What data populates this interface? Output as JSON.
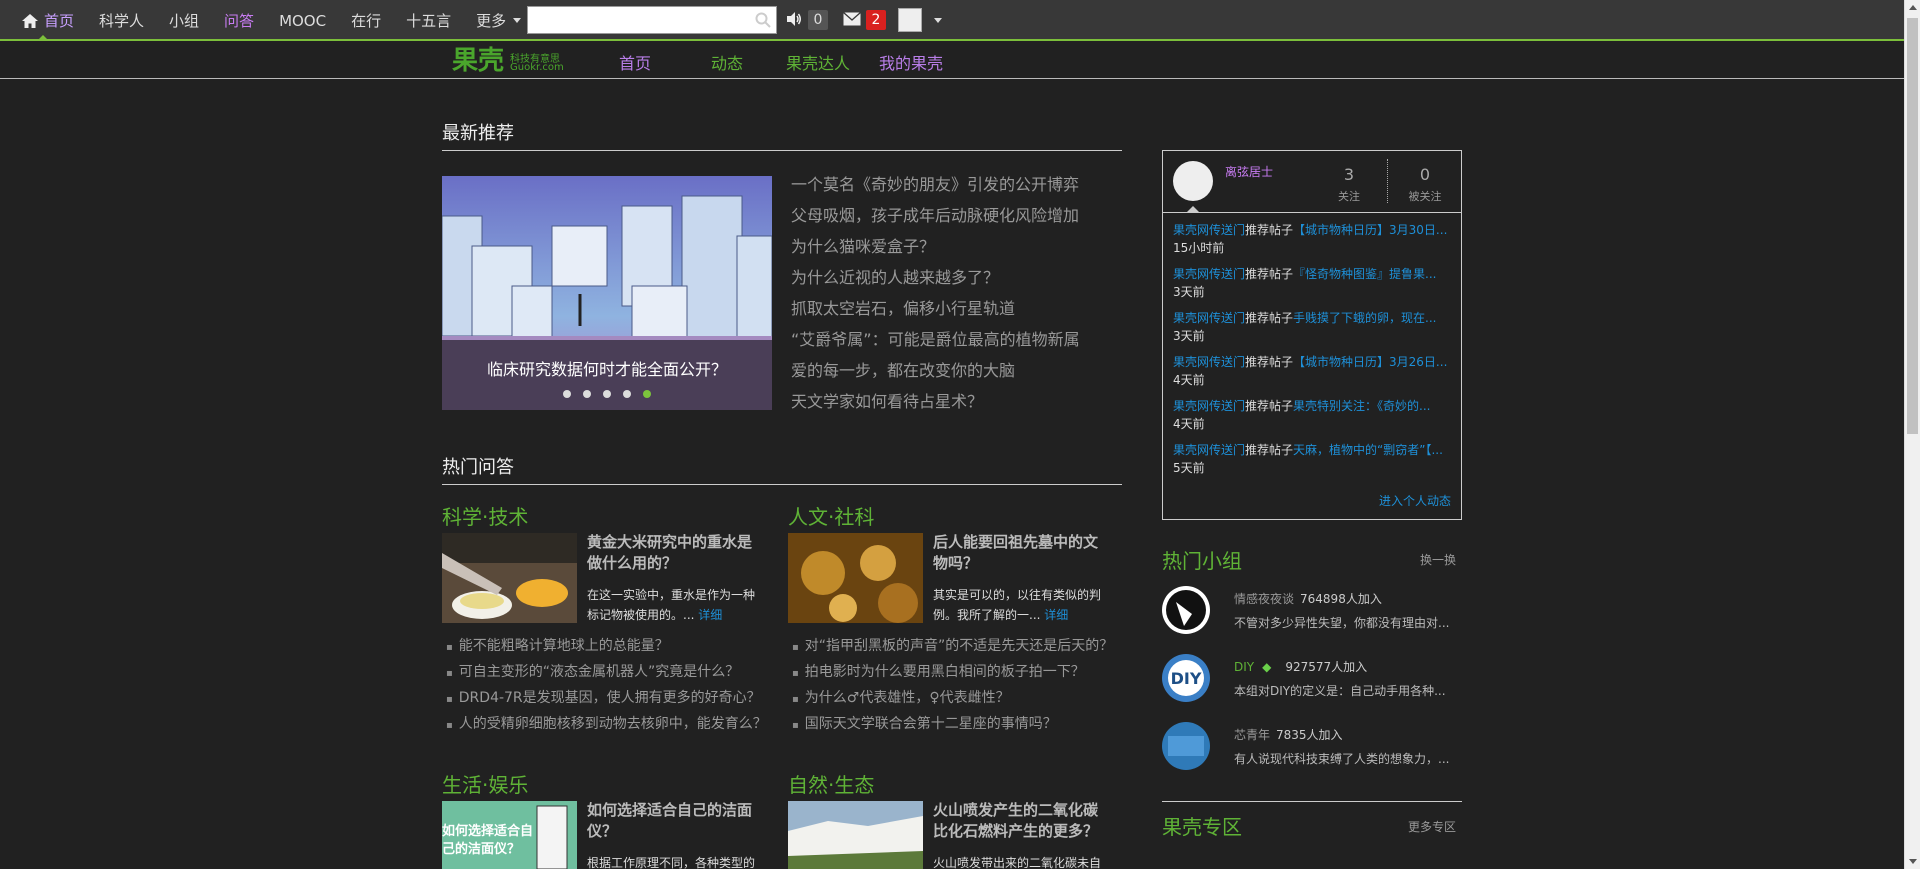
{
  "topnav": {
    "items": [
      "首页",
      "科学人",
      "小组",
      "问答",
      "MOOC",
      "在行",
      "十五言",
      "更多"
    ],
    "search_placeholder": "",
    "sound_count": "0",
    "message_count": "2"
  },
  "logo": {
    "main": "果壳",
    "tagline": "科技有意思",
    "domain": "Guokr.com"
  },
  "secnav": [
    "首页",
    "动态",
    "果壳达人",
    "我的果壳"
  ],
  "latest": {
    "title": "最新推荐",
    "featured_caption": "临床研究数据何时才能全面公开？",
    "items": [
      "一个莫名《奇妙的朋友》引发的公开博弈",
      "父母吸烟，孩子成年后动脉硬化风险增加",
      "为什么猫咪爱盒子？",
      "为什么近视的人越来越多了？",
      "抓取太空岩石，偏移小行星轨道",
      "“艾爵爷属”：可能是爵位最高的植物新属",
      "爱的每一步，都在改变你的大脑",
      "天文学家如何看待占星术？"
    ]
  },
  "hot_qa": {
    "title": "热门问答",
    "sections": [
      {
        "name": "科学·技术",
        "headline": "黄金大米研究中的重水是做什么用的？",
        "desc": "在这一实验中，重水是作为一种标记物被使用的。...",
        "more": "详细",
        "list": [
          "能不能粗略计算地球上的总能量？",
          "可自主变形的“液态金属机器人”究竟是什么？",
          "DRD4-7R是发现基因，使人拥有更多的好奇心？",
          "人的受精卵细胞核移到动物去核卵中，能发育么？"
        ]
      },
      {
        "name": "人文·社科",
        "headline": "后人能要回祖先墓中的文物吗？",
        "desc": "其实是可以的，以往有类似的判例。我所了解的一...",
        "more": "详细",
        "list": [
          "对“指甲刮黑板的声音”的不适是先天还是后天的？",
          "拍电影时为什么要用黑白相间的板子拍一下？",
          "为什么♂代表雄性，♀代表雌性？",
          "国际天文学联合会第十二星座的事情吗？"
        ]
      },
      {
        "name": "生活·娱乐",
        "headline": "如何选择适合自己的洁面仪？",
        "desc": "根据工作原理不同，各种类型的"
      },
      {
        "name": "自然·生态",
        "headline": "火山喷发产生的二氧化碳比化石燃料产生的更多？",
        "desc": "火山喷发带出来的二氧化碳未自"
      }
    ],
    "img3_text": "如何选择适合自己的洁面仪？"
  },
  "user": {
    "name": "离弦居士",
    "following": "3",
    "following_label": "关注",
    "followers": "0",
    "followers_label": "被关注",
    "feed": [
      {
        "src": "果壳网传送门",
        "act": "推荐帖子",
        "target": "【城市物种日历】3月30日...",
        "time": "15小时前"
      },
      {
        "src": "果壳网传送门",
        "act": "推荐帖子",
        "target": "『怪奇物种图鉴』提鲁果...",
        "time": "3天前"
      },
      {
        "src": "果壳网传送门",
        "act": "推荐帖子",
        "target": "手贱摸了下蛾的卵，现在...",
        "time": "3天前"
      },
      {
        "src": "果壳网传送门",
        "act": "推荐帖子",
        "target": "【城市物种日历】3月26日...",
        "time": "4天前"
      },
      {
        "src": "果壳网传送门",
        "act": "推荐帖子",
        "target": "果壳特别关注：《奇妙的...",
        "time": "4天前"
      },
      {
        "src": "果壳网传送门",
        "act": "推荐帖子",
        "target": "天麻，植物中的“剽窃者”【...",
        "time": "5天前"
      }
    ],
    "more": "进入个人动态"
  },
  "hot_groups": {
    "title": "热门小组",
    "refresh": "换一换",
    "items": [
      {
        "name": "情感夜夜谈",
        "count": "764898人加入",
        "desc": "不管对多少异性失望，你都没有理由对..."
      },
      {
        "name": "DIY",
        "count": "927577人加入",
        "desc": "本组对DIY的定义是：自己动手用各种..."
      },
      {
        "name": "芯青年",
        "count": "7835人加入",
        "desc": "有人说现代科技束缚了人类的想象力，..."
      }
    ]
  },
  "zone": {
    "title": "果壳专区",
    "more": "更多专区"
  }
}
